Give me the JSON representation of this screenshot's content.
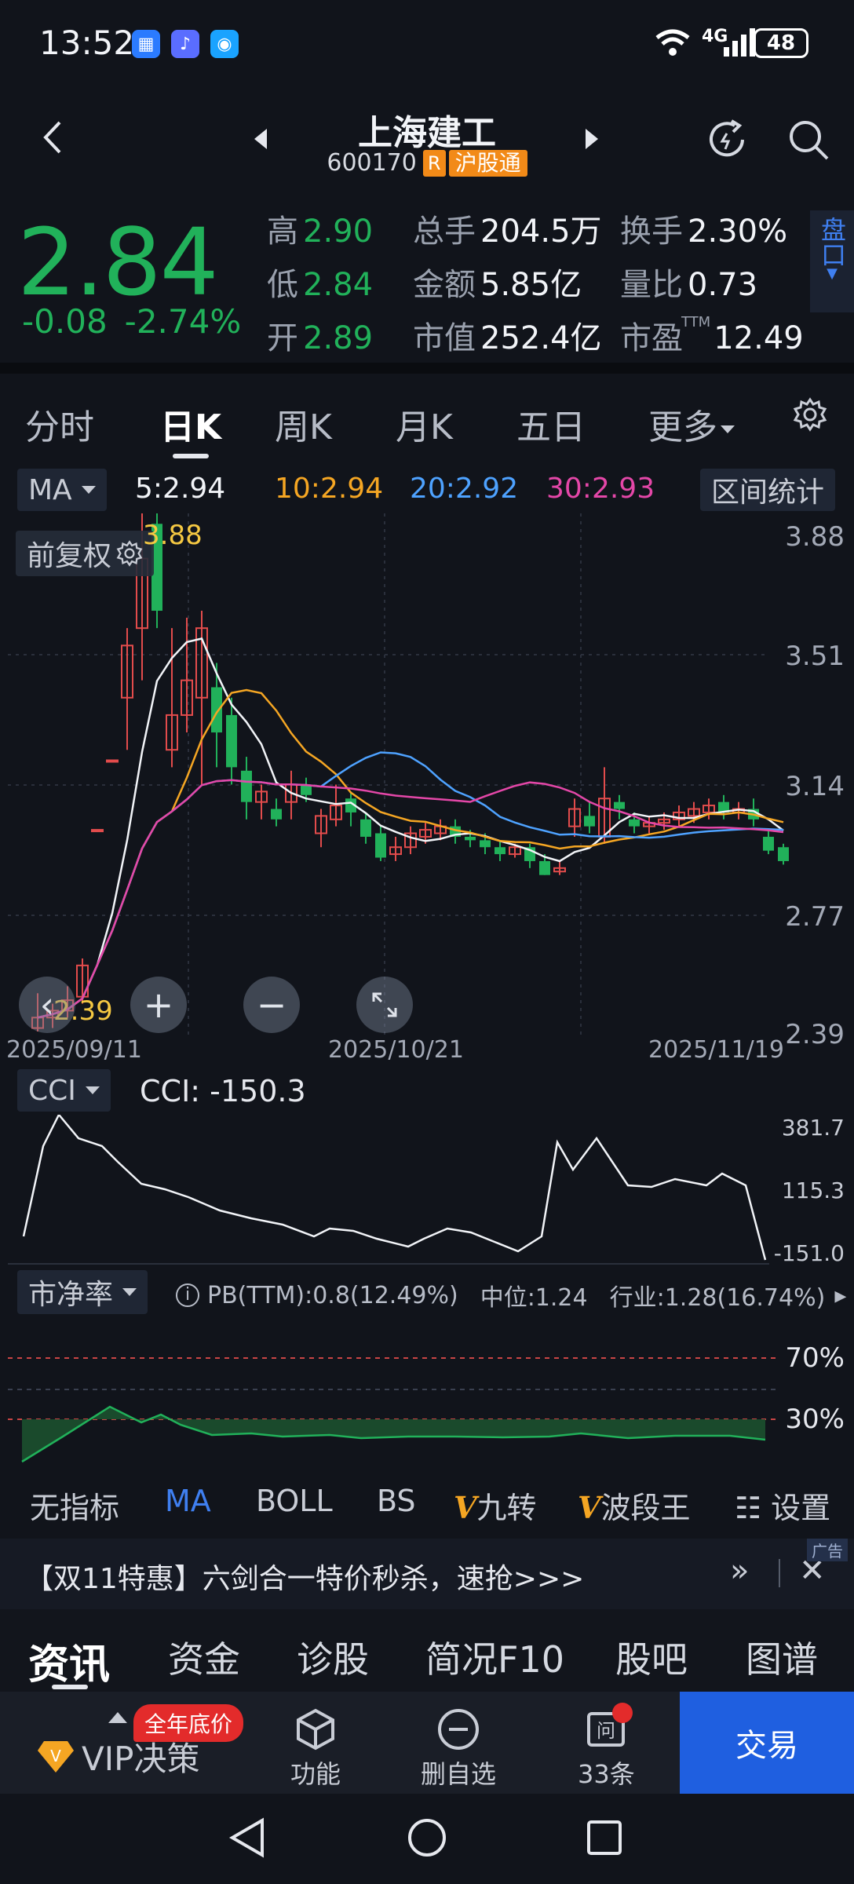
{
  "status": {
    "time": "13:52",
    "battery": "48",
    "network": "4G"
  },
  "header": {
    "title": "上海建工",
    "code": "600170",
    "badge_r": "R",
    "badge_connect": "沪股通"
  },
  "quote": {
    "price": "2.84",
    "change": "-0.08",
    "change_pct": "-2.74%",
    "high_label": "高",
    "high": "2.90",
    "low_label": "低",
    "low": "2.84",
    "open_label": "开",
    "open": "2.89",
    "vol_label": "总手",
    "vol": "204.5万",
    "turnover_label": "换手",
    "turnover": "2.30%",
    "amount_label": "金额",
    "amount": "5.85亿",
    "vol_ratio_label": "量比",
    "vol_ratio": "0.73",
    "mktcap_label": "市值",
    "mktcap": "252.4亿",
    "pe_label": "市盈",
    "pe_sup": "TTM",
    "pe": "12.49",
    "pankou": "盘口"
  },
  "tabs": [
    "分时",
    "日K",
    "周K",
    "月K",
    "五日",
    "更多"
  ],
  "ma_bar": {
    "selector": "MA",
    "ma5": "5:2.94",
    "ma10": "10:2.94",
    "ma20": "20:2.92",
    "ma30": "30:2.93",
    "interval_btn": "区间统计"
  },
  "kline": {
    "adjust_label": "前复权",
    "max_label": "3.88",
    "min_label": "2.39",
    "y_ticks": [
      "3.88",
      "3.51",
      "3.14",
      "2.77",
      "2.39"
    ],
    "x_ticks": [
      "2025/09/11",
      "2025/10/21",
      "2025/11/19"
    ]
  },
  "cci": {
    "selector": "CCI",
    "value": "CCI:  -150.3",
    "ticks": [
      "381.7",
      "115.3",
      "-151.0"
    ]
  },
  "pb": {
    "selector": "市净率",
    "info": "PB(TTM):0.8(12.49%)",
    "median": "中位:1.24",
    "industry": "行业:1.28(16.74%)",
    "ticks": [
      "70%",
      "30%"
    ]
  },
  "indicators": [
    "无指标",
    "MA",
    "BOLL",
    "BS",
    "九转",
    "波段王",
    "设置"
  ],
  "ad": {
    "text": "【双11特惠】六剑合一特价秒杀，速抢>>>",
    "tag": "广告"
  },
  "bottom_tabs": [
    "资讯",
    "资金",
    "诊股",
    "简况F10",
    "股吧",
    "图谱"
  ],
  "toolbar": {
    "vip": "VIP决策",
    "vip_badge": "全年底价",
    "func": "功能",
    "del": "删自选",
    "ask": "33条",
    "trade": "交易"
  },
  "colors": {
    "up": "#e34c4c",
    "down": "#21b15a",
    "ma5": "#f2f4f8",
    "ma10": "#f5a623",
    "ma20": "#4ea2ff",
    "ma30": "#e447a8"
  }
}
